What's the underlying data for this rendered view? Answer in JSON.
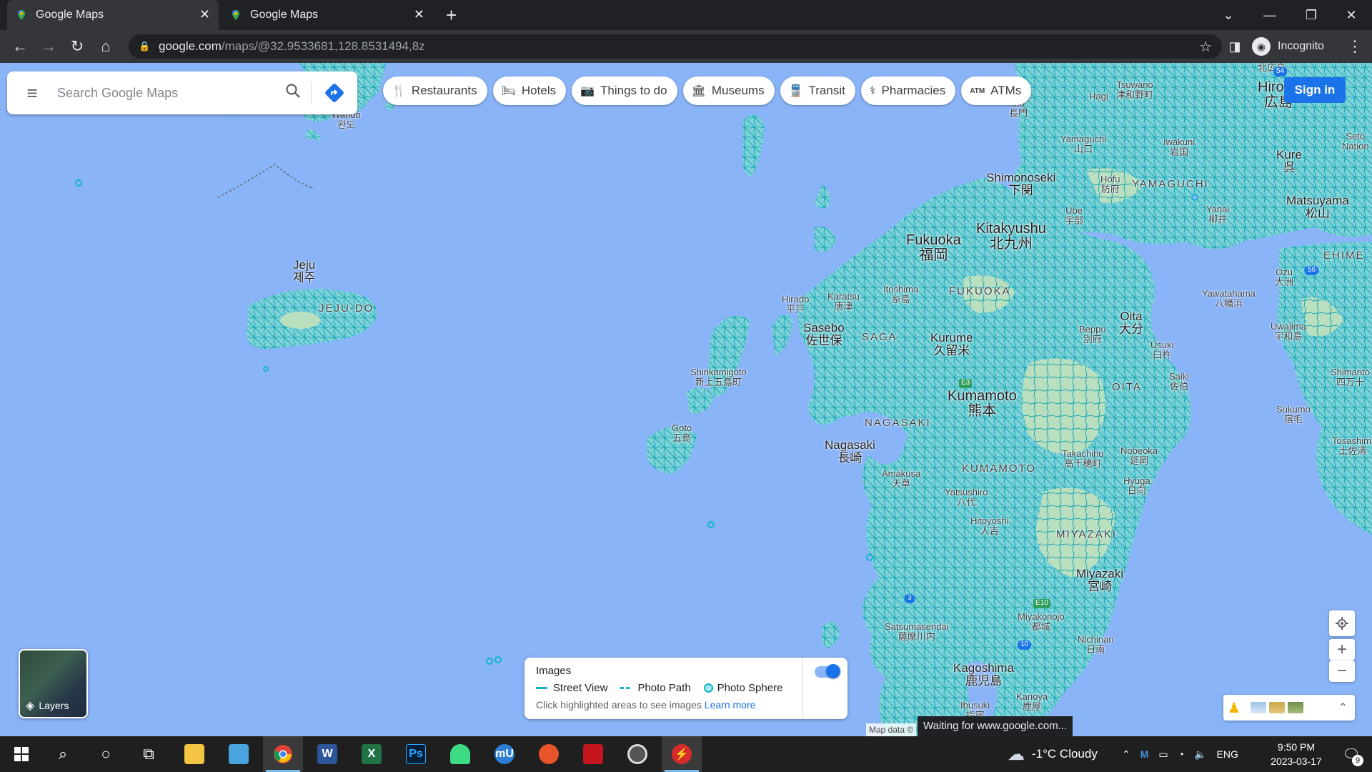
{
  "browser": {
    "tabs": [
      {
        "title": "Google Maps",
        "active": true
      },
      {
        "title": "Google Maps",
        "active": false
      }
    ],
    "new_tab_icon": "plus-icon",
    "url_host": "google.com",
    "url_path": "/maps/@32.9533681,128.8531494,8z",
    "profile_label": "Incognito"
  },
  "maps": {
    "search_placeholder": "Search Google Maps",
    "chips": [
      {
        "label": "Restaurants",
        "icon": "fork-knife-icon"
      },
      {
        "label": "Hotels",
        "icon": "bed-icon"
      },
      {
        "label": "Things to do",
        "icon": "camera-icon"
      },
      {
        "label": "Museums",
        "icon": "museum-icon"
      },
      {
        "label": "Transit",
        "icon": "train-icon"
      },
      {
        "label": "Pharmacies",
        "icon": "pharmacy-icon"
      },
      {
        "label": "ATMs",
        "icon": "atm-icon"
      }
    ],
    "signin_label": "Sign in",
    "layers_label": "Layers",
    "images_panel": {
      "title": "Images",
      "legend": [
        "Street View",
        "Photo Path",
        "Photo Sphere"
      ],
      "hint": "Click highlighted areas to see images",
      "learn_more": "Learn more",
      "toggle_on": true
    },
    "attribution": "Map data ©",
    "status": "Waiting for www.google.com...",
    "accent": "#1a73e8",
    "coverage_color": "#12b5cb",
    "water_color": "#8ab4f8",
    "labels": {
      "hiroshima": "Hirosh",
      "hiroshima_jp": "広島",
      "north_hiro": "北広島",
      "tsuwano": "Tsuwano",
      "tsuwano_jp": "津和野町",
      "hagi": "Hagi",
      "nagato_jp": "長門",
      "oto": "oto",
      "yamaguchi": "Yamaguchi",
      "yamaguchi_jp": "山口",
      "iwakuni": "Iwakuni",
      "iwakuni_jp": "岩国",
      "kure": "Kure",
      "kure_jp": "呉",
      "seto": "Seto",
      "nation": "Nation",
      "hofu": "Hofu",
      "hofu_jp": "防府",
      "yamaguchi_pref": "YAMAGUCHI",
      "shimonoseki": "Shimonoseki",
      "shimonoseki_jp": "下関",
      "ube": "Ube",
      "ube_jp": "宇部",
      "yanai": "Yanai",
      "yanai_jp": "柳井",
      "matsuyama": "Matsuyama",
      "matsuyama_jp": "松山",
      "ehime": "EHIME",
      "ozu": "Ozu",
      "ozu_jp": "大洲",
      "yawatahama": "Yawatahama",
      "yawatahama_jp": "八幡浜",
      "uwajima": "Uwajima",
      "uwajima_jp": "宇和島",
      "shimanto": "Shimanto",
      "shimanto_jp": "四万十",
      "sukumo": "Sukumo",
      "sukumo_jp": "宿毛",
      "tosashimizu": "Tosashimi",
      "tosashimizu_jp": "土佐清",
      "kitakyushu": "Kitakyushu",
      "kitakyushu_jp": "北九州",
      "fukuoka": "Fukuoka",
      "fukuoka_jp": "福岡",
      "fukuoka_pref": "FUKUOKA",
      "itoshima": "Itoshima",
      "itoshima_jp": "糸島",
      "karatsu": "Karatsu",
      "karatsu_jp": "唐津",
      "hirado": "Hirado",
      "hirado_jp": "平戸",
      "sasebo": "Sasebo",
      "sasebo_jp": "佐世保",
      "saga_pref": "SAGA",
      "kurume": "Kurume",
      "kurume_jp": "久留米",
      "oita": "Oita",
      "oita_jp": "大分",
      "oita_pref": "OITA",
      "beppu": "Beppu",
      "beppu_jp": "別府",
      "usuki": "Usuki",
      "usuki_jp": "臼杵",
      "saiki": "Saiki",
      "saiki_jp": "佐伯",
      "shinkamigoto": "Shinkamigoto",
      "shinkamigoto_jp": "新上五島町",
      "goto": "Goto",
      "goto_jp": "五島",
      "kumamoto": "Kumamoto",
      "kumamoto_jp": "熊本",
      "kumamoto_pref": "KUMAMOTO",
      "nagasaki": "Nagasaki",
      "nagasaki_jp": "長崎",
      "nagasaki_pref": "NAGASAKI",
      "takachiho": "Takachiho",
      "takachiho_jp": "高千穂町",
      "nobeoka": "Nobeoka",
      "nobeoka_jp": "延岡",
      "hyuga": "Hyuga",
      "hyuga_jp": "日向",
      "amakusa": "Amakusa",
      "amakusa_jp": "天草",
      "yatsushiro": "Yatsushiro",
      "yatsushiro_jp": "八代",
      "hitoyoshi": "Hitoyoshi",
      "hitoyoshi_jp": "人吉",
      "miyazaki_pref": "MIYAZAKI",
      "miyazaki": "Miyazaki",
      "miyazaki_jp": "宮崎",
      "satsumasendai": "Satsumasendai",
      "satsumasendai_jp": "薩摩川内",
      "miyakonojo": "Miyakonojo",
      "miyakonojo_jp": "都城",
      "nichinan": "Nichinan",
      "nichinan_jp": "日南",
      "kagoshima": "Kagoshima",
      "kagoshima_jp": "鹿児島",
      "kanoya": "Kanoya",
      "kanoya_jp": "鹿屋",
      "ibusuki": "Ibusuki",
      "ibusuki_jp": "指宿",
      "jeju": "Jeju",
      "jeju_kr": "제주",
      "jeju_do": "JEJU-DO",
      "wando": "Wando",
      "wando_kr": "완도",
      "e3": "E3",
      "e10": "E10",
      "r3": "3",
      "r10": "10",
      "r54": "54",
      "r56": "56"
    }
  },
  "taskbar": {
    "weather": "-1°C Cloudy",
    "language": "ENG",
    "time": "9:50 PM",
    "date": "2023-03-17",
    "notifications": "9",
    "apps": [
      {
        "name": "file-explorer",
        "label": "",
        "color": "#f4c542"
      },
      {
        "name": "control-panel",
        "label": "",
        "color": "#4aa3df"
      },
      {
        "name": "chrome",
        "label": "",
        "color": "#db4437"
      },
      {
        "name": "word",
        "label": "W",
        "color": "#2b579a"
      },
      {
        "name": "excel",
        "label": "X",
        "color": "#217346"
      },
      {
        "name": "photoshop",
        "label": "Ps",
        "color": "#001e36"
      },
      {
        "name": "android-app",
        "label": "",
        "color": "#3ddc84"
      },
      {
        "name": "mu-app",
        "label": "mU",
        "color": "#2d7dd2"
      },
      {
        "name": "media-app",
        "label": "",
        "color": "#e8542a"
      },
      {
        "name": "recorder-app",
        "label": "",
        "color": "#c4161c"
      },
      {
        "name": "disc-app",
        "label": "",
        "color": "#555555"
      },
      {
        "name": "flash-app",
        "label": "",
        "color": "#d62b2b"
      }
    ]
  }
}
